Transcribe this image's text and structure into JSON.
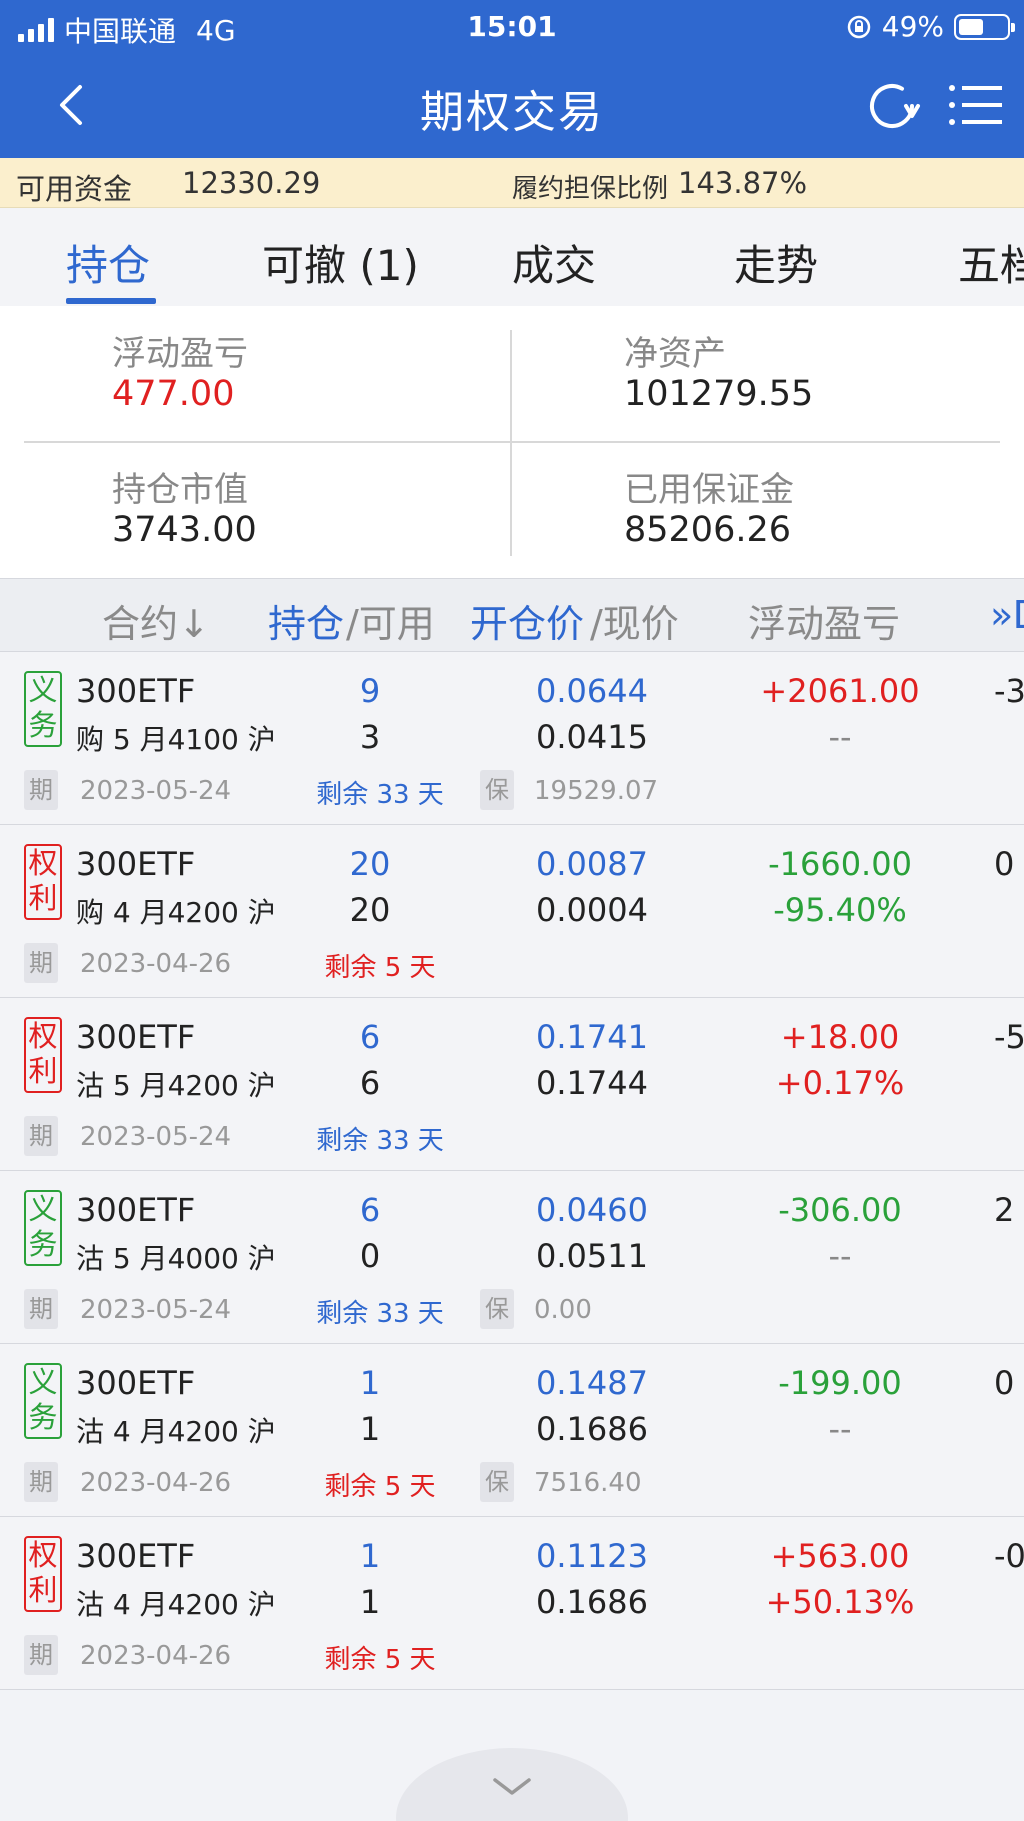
{
  "status_bar": {
    "carrier": "中国联通",
    "network": "4G",
    "time": "15:01",
    "battery": "49%"
  },
  "header": {
    "title": "期权交易"
  },
  "funds": {
    "available_label": "可用资金",
    "available_value": "12330.29",
    "ratio_label": "履约担保比例",
    "ratio_value": "143.87%"
  },
  "tabs": [
    {
      "label": "持仓",
      "active": true
    },
    {
      "label": "可撤 (1)",
      "active": false
    },
    {
      "label": "成交",
      "active": false
    },
    {
      "label": "走势",
      "active": false
    },
    {
      "label": "五档",
      "active": false
    }
  ],
  "summary": {
    "floating_pl_label": "浮动盈亏",
    "floating_pl_value": "477.00",
    "net_assets_label": "净资产",
    "net_assets_value": "101279.55",
    "market_value_label": "持仓市值",
    "market_value_value": "3743.00",
    "margin_used_label": "已用保证金",
    "margin_used_value": "85206.26"
  },
  "table_header": {
    "contract": "合约↓",
    "position": "持仓",
    "available": "/可用",
    "open_price": "开仓价",
    "current_price": "/现价",
    "floating_pl": "浮动盈亏",
    "more": "»D"
  },
  "positions": [
    {
      "type": "义务",
      "kind": "oblig",
      "name": "300ETF",
      "desc": "购 5 月4100 沪",
      "qty": "9",
      "avail": "3",
      "open": "0.0644",
      "cur": "0.0415",
      "pl": "+2061.00",
      "pl_dir": "pos",
      "pl_pct": "--",
      "extra": "-3",
      "date_tag": "期",
      "date": "2023-05-24",
      "remain": "剩余 33 天",
      "remain_color": "blue",
      "margin_tag": "保",
      "margin": "19529.07"
    },
    {
      "type": "权利",
      "kind": "right",
      "name": "300ETF",
      "desc": "购 4 月4200 沪",
      "qty": "20",
      "avail": "20",
      "open": "0.0087",
      "cur": "0.0004",
      "pl": "-1660.00",
      "pl_dir": "neg",
      "pl_pct": "-95.40%",
      "extra": "0",
      "date_tag": "期",
      "date": "2023-04-26",
      "remain": "剩余 5 天",
      "remain_color": "red",
      "margin_tag": "",
      "margin": ""
    },
    {
      "type": "权利",
      "kind": "right",
      "name": "300ETF",
      "desc": "沽 5 月4200 沪",
      "qty": "6",
      "avail": "6",
      "open": "0.1741",
      "cur": "0.1744",
      "pl": "+18.00",
      "pl_dir": "pos",
      "pl_pct": "+0.17%",
      "extra": "-5",
      "date_tag": "期",
      "date": "2023-05-24",
      "remain": "剩余 33 天",
      "remain_color": "blue",
      "margin_tag": "",
      "margin": ""
    },
    {
      "type": "义务",
      "kind": "oblig",
      "name": "300ETF",
      "desc": "沽 5 月4000 沪",
      "qty": "6",
      "avail": "0",
      "open": "0.0460",
      "cur": "0.0511",
      "pl": "-306.00",
      "pl_dir": "neg",
      "pl_pct": "--",
      "extra": "2",
      "date_tag": "期",
      "date": "2023-05-24",
      "remain": "剩余 33 天",
      "remain_color": "blue",
      "margin_tag": "保",
      "margin": "0.00"
    },
    {
      "type": "义务",
      "kind": "oblig",
      "name": "300ETF",
      "desc": "沽 4 月4200 沪",
      "qty": "1",
      "avail": "1",
      "open": "0.1487",
      "cur": "0.1686",
      "pl": "-199.00",
      "pl_dir": "neg",
      "pl_pct": "--",
      "extra": "0",
      "date_tag": "期",
      "date": "2023-04-26",
      "remain": "剩余 5 天",
      "remain_color": "red",
      "margin_tag": "保",
      "margin": "7516.40"
    },
    {
      "type": "权利",
      "kind": "right",
      "name": "300ETF",
      "desc": "沽 4 月4200 沪",
      "qty": "1",
      "avail": "1",
      "open": "0.1123",
      "cur": "0.1686",
      "pl": "+563.00",
      "pl_dir": "pos",
      "pl_pct": "+50.13%",
      "extra": "-0",
      "date_tag": "期",
      "date": "2023-04-26",
      "remain": "剩余 5 天",
      "remain_color": "red",
      "margin_tag": "",
      "margin": ""
    }
  ],
  "colors": {
    "brand": "#2f68cf",
    "up": "#e02020",
    "down": "#2aa13a",
    "fund_bar": "#fbefcd"
  }
}
